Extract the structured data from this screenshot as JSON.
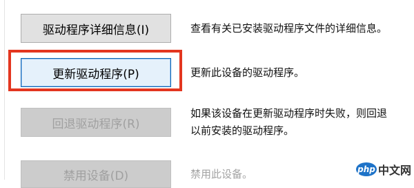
{
  "driver_actions": [
    {
      "button_label": "驱动程序详细信息(I)",
      "description": "查看有关已安装驱动程序文件的详细信息。"
    },
    {
      "button_label": "更新驱动程序(P)",
      "description": "更新此设备的驱动程序。"
    },
    {
      "button_label": "回退驱动程序(R)",
      "description_line1": "如果该设备在更新驱动程序时失败，则回退",
      "description_line2": "以前安装的驱动程序。"
    },
    {
      "button_label": "禁用设备(D)",
      "description": "禁用此设备。"
    }
  ],
  "watermark": {
    "logo_text": "php",
    "text": "中文网"
  },
  "colors": {
    "highlight": "#e3361f",
    "focus_border": "#0a64b4",
    "button_bg": "#e1e1e1",
    "disabled_text": "#a0a0a0"
  }
}
